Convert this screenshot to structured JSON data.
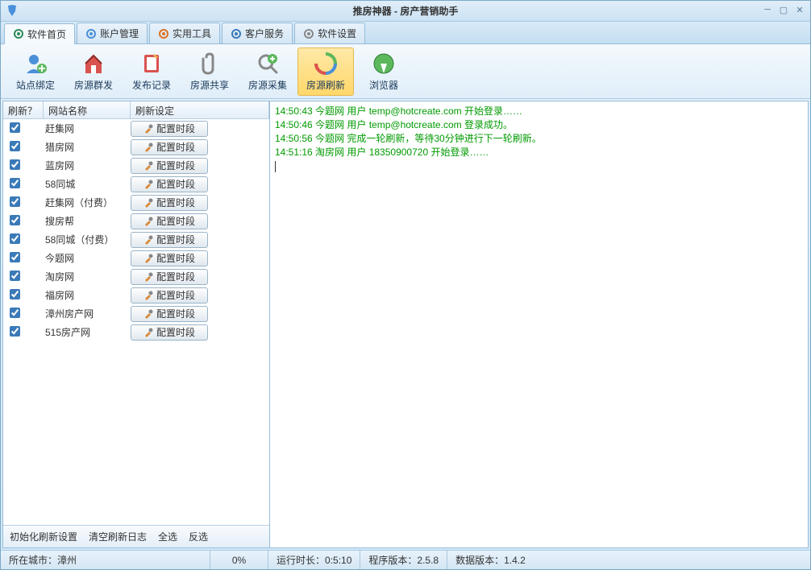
{
  "window": {
    "title": "推房神器 - 房产营销助手"
  },
  "tabs": [
    {
      "label": "软件首页",
      "active": true
    },
    {
      "label": "账户管理",
      "active": false
    },
    {
      "label": "实用工具",
      "active": false
    },
    {
      "label": "客户服务",
      "active": false
    },
    {
      "label": "软件设置",
      "active": false
    }
  ],
  "toolbar": [
    {
      "label": "站点绑定",
      "active": false,
      "icon": "user-add"
    },
    {
      "label": "房源群发",
      "active": false,
      "icon": "house-send"
    },
    {
      "label": "发布记录",
      "active": false,
      "icon": "notebook"
    },
    {
      "label": "房源共享",
      "active": false,
      "icon": "clip"
    },
    {
      "label": "房源采集",
      "active": false,
      "icon": "search-plus"
    },
    {
      "label": "房源刷新",
      "active": true,
      "icon": "refresh"
    },
    {
      "label": "浏览器",
      "active": false,
      "icon": "browser"
    }
  ],
  "grid": {
    "headers": {
      "c1": "刷新？",
      "c2": "网站名称",
      "c3": "刷新设定"
    },
    "config_button_label": "配置时段",
    "rows": [
      {
        "checked": true,
        "name": "赶集网"
      },
      {
        "checked": true,
        "name": "猎房网"
      },
      {
        "checked": true,
        "name": "蓝房网"
      },
      {
        "checked": true,
        "name": "58同城"
      },
      {
        "checked": true,
        "name": "赶集网（付费）"
      },
      {
        "checked": true,
        "name": "搜房帮"
      },
      {
        "checked": true,
        "name": "58同城（付费）"
      },
      {
        "checked": true,
        "name": "今题网"
      },
      {
        "checked": true,
        "name": "淘房网"
      },
      {
        "checked": true,
        "name": "福房网"
      },
      {
        "checked": true,
        "name": "漳州房产网"
      },
      {
        "checked": true,
        "name": "515房产网"
      }
    ]
  },
  "left_footer": {
    "init": "初始化刷新设置",
    "clear": "清空刷新日志",
    "select_all": "全选",
    "invert": "反选"
  },
  "log": [
    "14:50:43 今题网 用户 temp@hotcreate.com 开始登录……",
    "14:50:46 今题网 用户 temp@hotcreate.com 登录成功。",
    "14:50:56 今题网 完成一轮刷新，等待30分钟进行下一轮刷新。",
    "14:51:16 淘房网 用户 18350900720 开始登录……"
  ],
  "status": {
    "city_label": "所在城市：",
    "city_value": "漳州",
    "percent": "0%",
    "runtime_label": "运行时长：",
    "runtime_value": "0:5:10",
    "program_ver_label": "程序版本：",
    "program_ver_value": "2.5.8",
    "data_ver_label": "数据版本：",
    "data_ver_value": "1.4.2"
  }
}
